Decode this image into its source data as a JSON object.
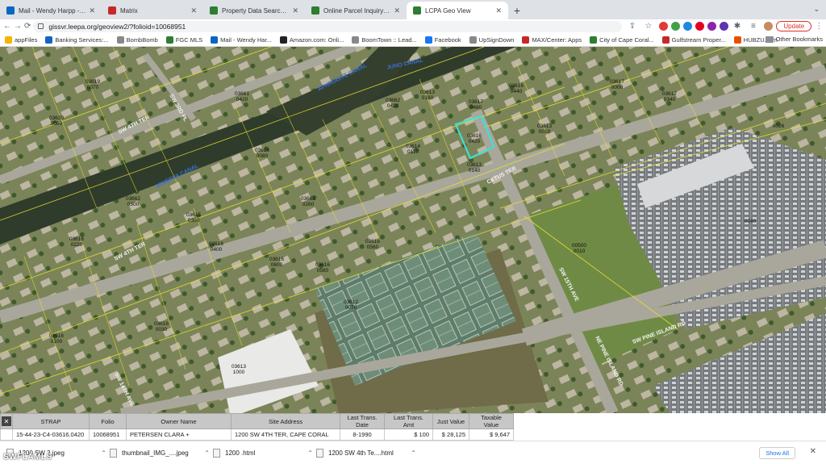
{
  "tabs": [
    {
      "label": "Mail - Wendy Harpp - Outlook",
      "color": "#0a66c2",
      "active": false
    },
    {
      "label": "Matrix",
      "color": "#c62828",
      "active": false
    },
    {
      "label": "Property Data Search | Lee Co",
      "color": "#2e7d32",
      "active": false
    },
    {
      "label": "Online Parcel Inquiry | Lee Co",
      "color": "#2e7d32",
      "active": false
    },
    {
      "label": "LCPA Geo View",
      "color": "#2e7d32",
      "active": true
    }
  ],
  "address": {
    "url": "gissvr.leepa.org/geoview2/?folioid=10068951",
    "update_label": "Update"
  },
  "bookmarks": [
    {
      "label": "appFiles",
      "color": "#f4b400"
    },
    {
      "label": "Banking Services:...",
      "color": "#1565c0"
    },
    {
      "label": "BombBomb",
      "color": "#888888"
    },
    {
      "label": "FGC MLS",
      "color": "#2e7d32"
    },
    {
      "label": "Mail - Wendy Har...",
      "color": "#0a66c2"
    },
    {
      "label": "Amazon.com: Onli...",
      "color": "#222222"
    },
    {
      "label": "BoomTown :: Lead...",
      "color": "#888888"
    },
    {
      "label": "Facebook",
      "color": "#1877f2"
    },
    {
      "label": "UpSignDown",
      "color": "#888888"
    },
    {
      "label": "MAX/Center: Apps",
      "color": "#c62828"
    },
    {
      "label": "City of Cape Coral...",
      "color": "#2e7d32"
    },
    {
      "label": "Gulfstream Proper...",
      "color": "#c62828"
    },
    {
      "label": "HUBZU.com",
      "color": "#e65100"
    }
  ],
  "other_bookmarks": "Other Bookmarks",
  "map": {
    "street_labels": {
      "aphrodite_canal": "APHRODITE CANAL",
      "juno_canal": "JUNO CANAL",
      "minerva_canal": "MINERVA CANAL",
      "sw_4th_ter_top": "SW 4TH TER",
      "sw_4th_ter": "SW 4TH TER",
      "cetus_ter": "CETUS TER",
      "sw_15th_ave": "SW 15TH AVE",
      "ne_pine_island_rd": "NE PINE ISLAND RD",
      "sw_pine_island_rd": "SW PINE ISLAND RD",
      "sw_14th_ave": "SW 14TH AVE",
      "sw_3rd_pl": "SW 3RD PL"
    },
    "parcel_labels": [
      {
        "t1": "03616",
        "t2": "0420"
      },
      {
        "t1": "03618",
        "t2": "0000"
      },
      {
        "t1": "03613",
        "t2": "1000"
      },
      {
        "t1": "00500",
        "t2": "0010"
      },
      {
        "t1": "03613",
        "t2": "0160"
      },
      {
        "t1": "03612",
        "t2": "0070"
      },
      {
        "t1": "03614",
        "t2": "0110"
      },
      {
        "t1": "03616",
        "t2": "0600"
      },
      {
        "t1": "03616",
        "t2": "0560"
      },
      {
        "t1": "03616",
        "t2": "0580"
      },
      {
        "t1": "03662",
        "t2": "0420"
      },
      {
        "t1": "03661",
        "t2": "0420"
      },
      {
        "t1": "03617",
        "t2": "0480"
      },
      {
        "t1": "03613",
        "t2": "0010"
      },
      {
        "t1": "03615",
        "t2": "0300"
      },
      {
        "t1": "03617",
        "t2": "0000"
      },
      {
        "t1": "03616",
        "t2": "0220"
      },
      {
        "t1": "03616",
        "t2": "0400"
      },
      {
        "t1": "03616",
        "t2": "0100"
      },
      {
        "t1": "03616",
        "t2": "0030"
      },
      {
        "t1": "03613",
        "t2": "0140"
      },
      {
        "t1": "03661",
        "t2": "0260"
      },
      {
        "t1": "03662",
        "t2": "0300"
      },
      {
        "t1": "0040",
        "t2": ""
      },
      {
        "t1": "0026",
        "t2": ""
      },
      {
        "t1": "03617",
        "t2": "0340"
      },
      {
        "t1": "03619",
        "t2": "0070"
      },
      {
        "t1": "03620",
        "t2": "0060"
      },
      {
        "t1": "03616",
        "t2": "0440"
      },
      {
        "t1": "03616",
        "t2": "0080"
      }
    ]
  },
  "table": {
    "headers": [
      "STRAP",
      "Folio",
      "Owner Name",
      "Site Address",
      "Last Trans. Date",
      "Last Trans. Amt",
      "Just Value",
      "Taxable Value"
    ],
    "rows": [
      [
        "15-44-23-C4-03616.0420",
        "10068951",
        "PETERSEN CLARA +",
        "1200 SW 4TH TER, CAPE CORAL",
        "8-1990",
        "$ 100",
        "$ 28,125",
        "$ 9,647"
      ]
    ]
  },
  "downloads": [
    {
      "label": "1200 SW 2.jpeg"
    },
    {
      "label": "thumbnail_IMG_....jpeg"
    },
    {
      "label": "1200 .html"
    },
    {
      "label": "1200 SW 4th Te....html"
    }
  ],
  "show_all": "Show All",
  "watermark": "SWFLAMLS"
}
